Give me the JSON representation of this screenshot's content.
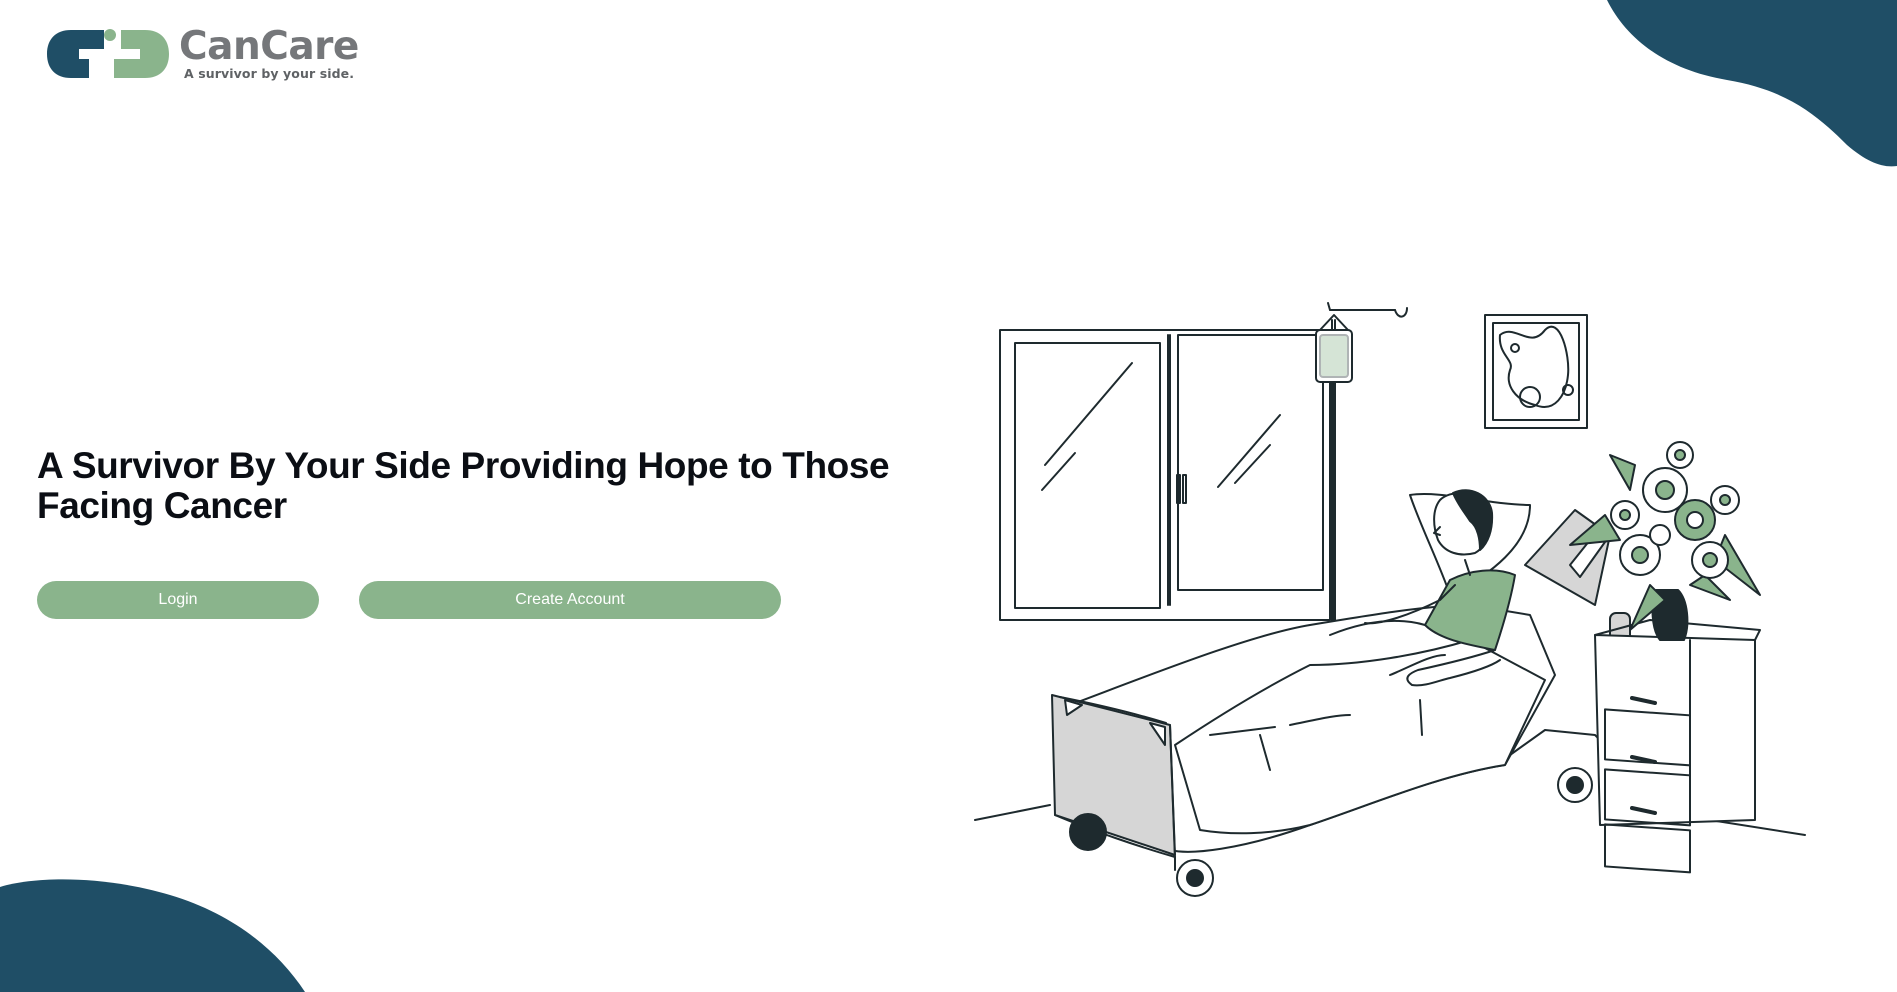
{
  "brand": {
    "name": "CanCare",
    "tagline": "A survivor by your side.",
    "colors": {
      "primary_dark": "#1f4e66",
      "accent_green": "#8ab48c",
      "text_dark": "#0b0e14",
      "logo_gray": "#75777a"
    }
  },
  "hero": {
    "title": "A Survivor By Your Side Providing Hope to Those Facing Cancer"
  },
  "actions": {
    "login_label": "Login",
    "create_account_label": "Create Account"
  },
  "illustration": {
    "subject": "patient-in-hospital-bed-illustration"
  }
}
